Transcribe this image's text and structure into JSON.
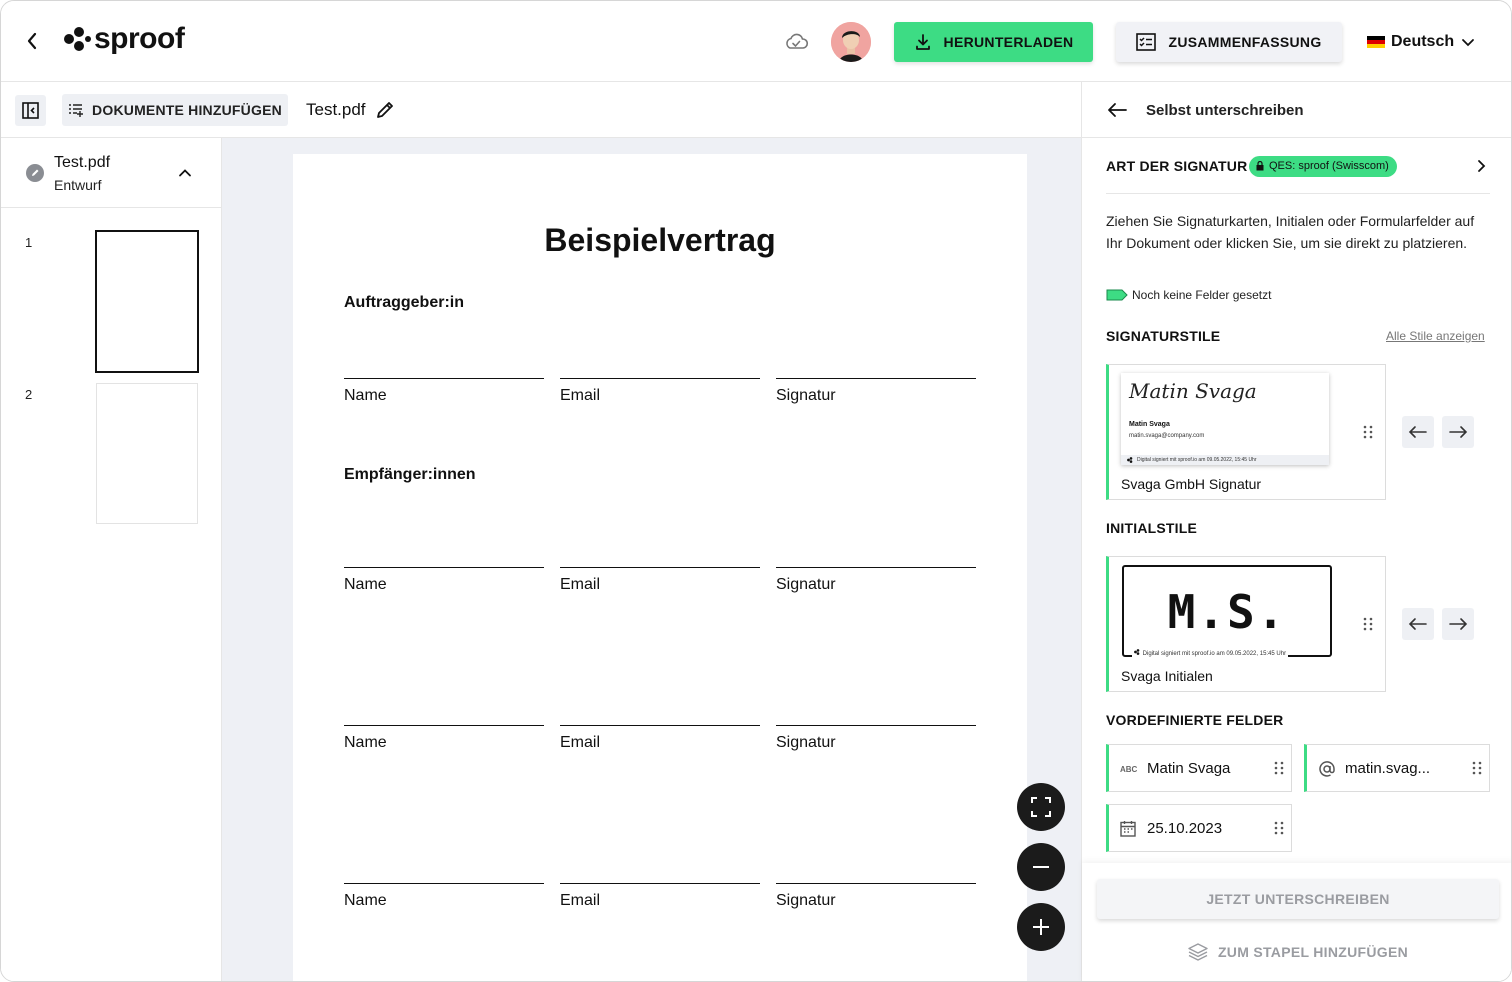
{
  "app": {
    "logo_text": "sproof",
    "download_label": "HERUNTERLADEN",
    "summary_label": "ZUSAMMENFASSUNG",
    "language": "Deutsch"
  },
  "toolbar": {
    "add_documents_label": "DOKUMENTE HINZUFÜGEN",
    "document_name": "Test.pdf"
  },
  "sidebar": {
    "file_name": "Test.pdf",
    "file_state": "Entwurf",
    "pages": [
      "1",
      "2"
    ]
  },
  "document": {
    "title": "Beispielvertrag",
    "section_client": "Auftraggeber:in",
    "section_recipients": "Empfänger:innen",
    "label_name": "Name",
    "label_email": "Email",
    "label_signature": "Signatur"
  },
  "panel": {
    "title": "Selbst unterschreiben",
    "signature_type_label": "ART DER SIGNATUR",
    "signature_type_badge": "QES: sproof (Swisscom)",
    "instructions": "Ziehen Sie Signaturkarten, Initialen oder Formularfelder auf Ihr Dokument oder klicken Sie, um sie direkt zu platzieren.",
    "no_fields": "Noch keine Felder gesetzt",
    "signature_styles_label": "SIGNATURSTILE",
    "show_all_styles": "Alle Stile anzeigen",
    "signature_card": {
      "script_name": "Matin Svaga",
      "name": "Matin Svaga",
      "email": "matin.svaga@company.com",
      "footer": "Digital signiert mit sproof.io am 09.05.2022, 15:45 Uhr",
      "caption": "Svaga GmbH Signatur"
    },
    "initial_styles_label": "INITIALSTILE",
    "initial_card": {
      "initials": "M.S.",
      "footer": "Digital signiert mit sproof.io am 09.05.2022, 15:45 Uhr",
      "caption": "Svaga Initialen"
    },
    "predefined_fields_label": "VORDEFINIERTE FELDER",
    "fields": {
      "name": "Matin Svaga",
      "email": "matin.svag...",
      "date": "25.10.2023"
    },
    "sign_now": "JETZT UNTERSCHREIBEN",
    "add_to_stack": "ZUM STAPEL HINZUFÜGEN"
  },
  "colors": {
    "accent": "#3ddc84",
    "dark_button": "#1b1b1b",
    "doc_background": "#eef0f5"
  }
}
